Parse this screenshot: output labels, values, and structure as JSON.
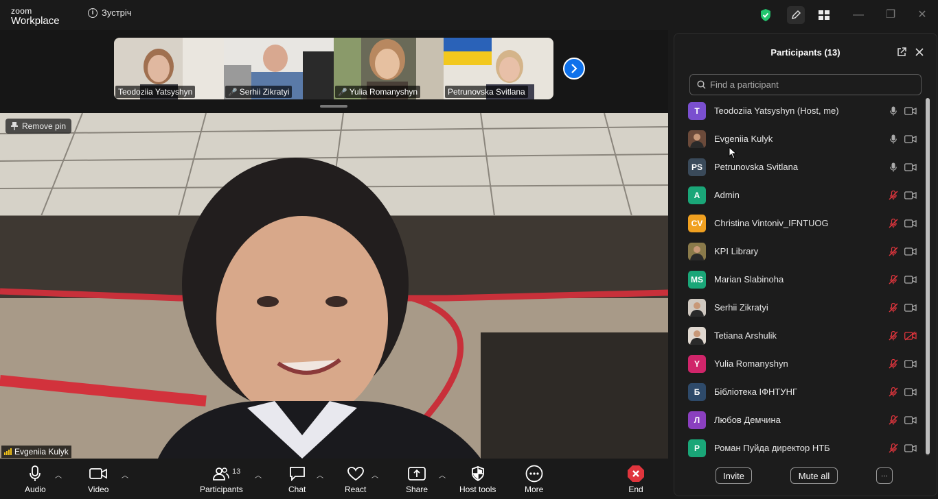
{
  "app": {
    "logo_top": "zoom",
    "logo_bottom": "Workplace",
    "meeting_title": "Зустріч"
  },
  "thumbnails": [
    {
      "name": "Teodoziia Yatsyshyn",
      "muted": false
    },
    {
      "name": "Serhii Zikratyi",
      "muted": true
    },
    {
      "name": "Yulia Romanyshyn",
      "muted": true
    },
    {
      "name": "Petrunovska Svitlana",
      "muted": false
    }
  ],
  "main": {
    "remove_pin": "Remove pin",
    "speaker": "Evgeniia Kulyk"
  },
  "toolbar": {
    "audio": "Audio",
    "video": "Video",
    "participants": "Participants",
    "participants_count": "13",
    "chat": "Chat",
    "react": "React",
    "share": "Share",
    "host_tools": "Host tools",
    "more": "More",
    "end": "End"
  },
  "panel": {
    "title": "Participants (13)",
    "search_placeholder": "Find a participant",
    "invite": "Invite",
    "mute_all": "Mute all",
    "more": "···",
    "participants": [
      {
        "initials": "T",
        "color": "#7a4fcf",
        "name": "Teodoziia Yatsyshyn (Host, me)",
        "mic": "on",
        "cam": "off"
      },
      {
        "initials": "",
        "color": "#6b4a3a",
        "name": "Evgeniia Kulyk",
        "mic": "on",
        "cam": "off"
      },
      {
        "initials": "PS",
        "color": "#3a4a5a",
        "name": "Petrunovska Svitlana",
        "mic": "on",
        "cam": "off"
      },
      {
        "initials": "A",
        "color": "#1aa678",
        "name": "Admin",
        "mic": "muted",
        "cam": "off"
      },
      {
        "initials": "CV",
        "color": "#f0a020",
        "name": "Christina Vintoniv_IFNTUOG",
        "mic": "muted",
        "cam": "off"
      },
      {
        "initials": "",
        "color": "#8a7a4a",
        "name": "KPI Library",
        "mic": "muted",
        "cam": "off"
      },
      {
        "initials": "MS",
        "color": "#1aa678",
        "name": "Marian Slabinoha",
        "mic": "muted",
        "cam": "off"
      },
      {
        "initials": "",
        "color": "#cfc8c0",
        "name": "Serhii Zikratyi",
        "mic": "muted",
        "cam": "off"
      },
      {
        "initials": "",
        "color": "#e0d8d0",
        "name": "Tetiana Arshulik",
        "mic": "muted",
        "cam": "disabled"
      },
      {
        "initials": "Y",
        "color": "#d0256a",
        "name": "Yulia Romanyshyn",
        "mic": "muted",
        "cam": "off"
      },
      {
        "initials": "Б",
        "color": "#2e4a6a",
        "name": "Бібліотека ІФНТУНГ",
        "mic": "muted",
        "cam": "off"
      },
      {
        "initials": "Л",
        "color": "#8a3fbf",
        "name": "Любов Демчина",
        "mic": "muted",
        "cam": "off"
      },
      {
        "initials": "Р",
        "color": "#1aa678",
        "name": "Роман Пуйда директор НТБ",
        "mic": "muted",
        "cam": "off"
      }
    ]
  }
}
